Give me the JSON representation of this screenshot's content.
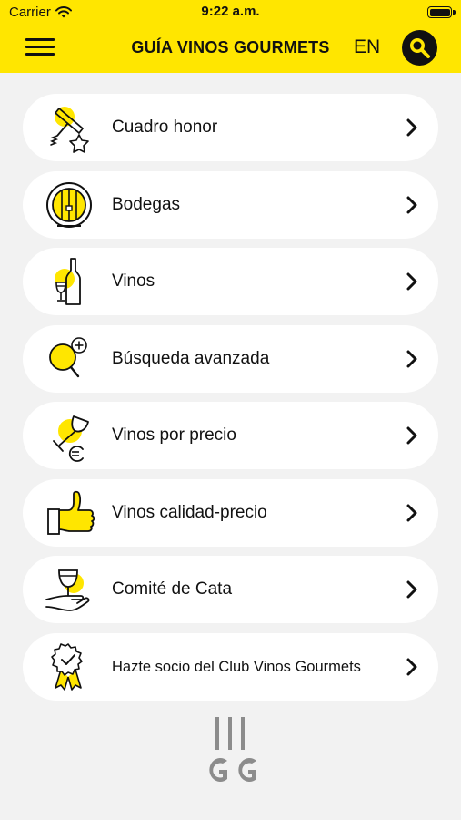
{
  "status_bar": {
    "carrier": "Carrier",
    "time": "9:22 a.m."
  },
  "nav": {
    "title": "GUÍA VINOS GOURMETS",
    "language": "EN",
    "menu_icon": "hamburger-icon",
    "search_icon": "search-icon"
  },
  "menu": {
    "items": [
      {
        "label": "Cuadro honor",
        "icon": "corkscrew-star-icon"
      },
      {
        "label": "Bodegas",
        "icon": "barrel-icon"
      },
      {
        "label": "Vinos",
        "icon": "wine-bottle-icon"
      },
      {
        "label": "Búsqueda avanzada",
        "icon": "advanced-search-icon"
      },
      {
        "label": "Vinos por precio",
        "icon": "glass-euro-icon"
      },
      {
        "label": "Vinos calidad-precio",
        "icon": "thumbs-up-icon"
      },
      {
        "label": "Comité de Cata",
        "icon": "tasting-hand-icon"
      },
      {
        "label": "Hazte socio del Club Vinos Gourmets",
        "icon": "award-badge-icon"
      }
    ]
  },
  "colors": {
    "accent": "#ffe600",
    "background": "#f2f2f2",
    "card": "#ffffff",
    "text": "#111111",
    "logo": "#8c8c8c"
  }
}
